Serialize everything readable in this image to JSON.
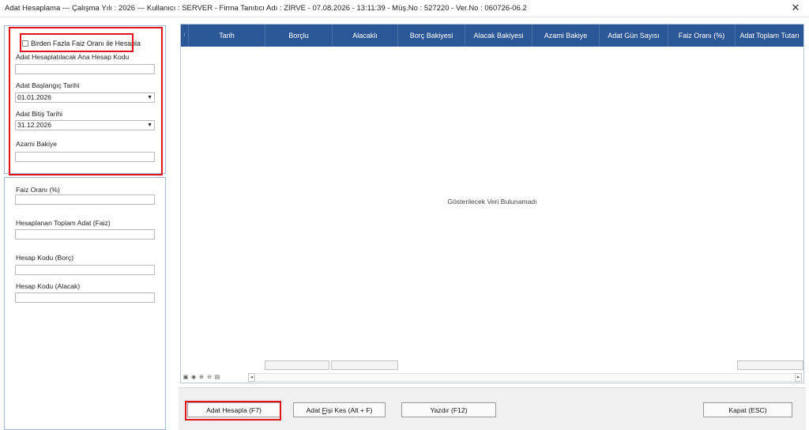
{
  "window": {
    "title": "Adat Hesaplama  ---  Çalışma Yılı : 2026  ---  Kullanıcı : SERVER - Firma Tanıtıcı Adı : ZİRVE - 07.08.2026 - 13:11:39 - Müş.No : 527220 - Ver.No : 060726-06.2",
    "close_glyph": "✕"
  },
  "top_panel": {
    "multi_rate_checkbox_label": "Birden Fazla Faiz Oranı ile Hesapla",
    "multi_rate_checked": false,
    "account_code_label": "Adat Hesaplatılacak Ana Hesap Kodu",
    "account_code_value": "",
    "start_date_label": "Adat Başlangıç Tarihi",
    "start_date_value": "01.01.2026",
    "end_date_label": "Adat Bitiş Tarihi",
    "end_date_value": "31.12.2026",
    "max_balance_label": "Azami Bakiye",
    "max_balance_value": ""
  },
  "bottom_panel": {
    "interest_rate_label": "Faiz Oranı (%)",
    "interest_rate_value": "",
    "total_adat_label": "Hesaplanan Toplam Adat (Faiz)",
    "total_adat_value": "",
    "debit_account_label": "Hesap Kodu (Borç)",
    "debit_account_value": "",
    "credit_account_label": "Hesap Kodu (Alacak)",
    "credit_account_value": ""
  },
  "grid": {
    "indicator_glyph": "⁞",
    "columns": [
      "Tarih",
      "Borçlu",
      "Alacaklı",
      "Borç Bakiyesi",
      "Alacak Bakiyesi",
      "Azami Bakiye",
      "Adat Gün Sayısı",
      "Faiz Oranı (%)",
      "Adat Toplam Tutarı"
    ],
    "rows": [],
    "empty_message": "Gösterilecek Veri Bulunamadı"
  },
  "buttons": {
    "calculate": "Adat Hesapla (F7)",
    "issue_slip_pre": "Adat ",
    "issue_slip_mnemonic": "F",
    "issue_slip_post": "işi Kes (Alt + F)",
    "print": "Yazdır (F12)",
    "close": "Kapat (ESC)"
  },
  "colors": {
    "grid_header": "#2b5796",
    "highlight": "#e0161c",
    "panel_border": "#9db8d8"
  }
}
